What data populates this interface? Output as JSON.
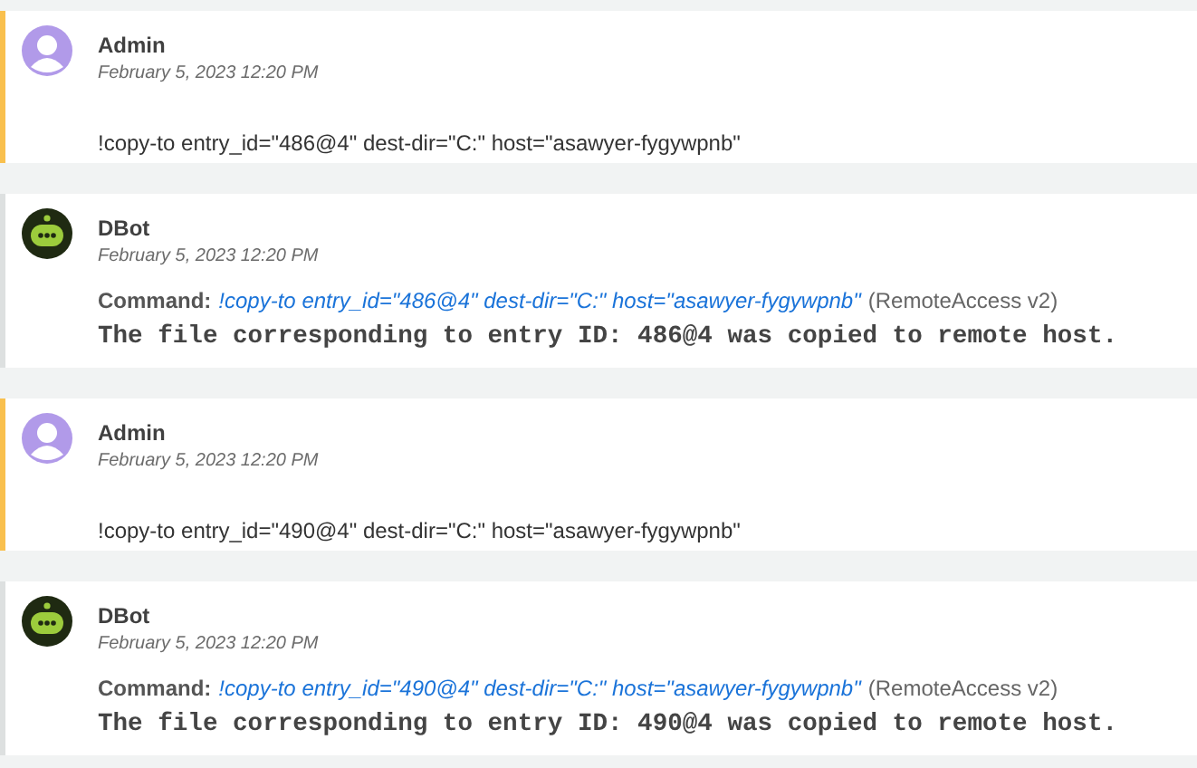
{
  "entries": [
    {
      "kind": "user",
      "author": "Admin",
      "time": "February 5, 2023 12:20 PM",
      "message": "!copy-to entry_id=\"486@4\" dest-dir=\"C:\" host=\"asawyer-fygywpnb\""
    },
    {
      "kind": "bot",
      "author": "DBot",
      "time": "February 5, 2023 12:20 PM",
      "command_label": "Command:",
      "command": "!copy-to entry_id=\"486@4\" dest-dir=\"C:\" host=\"asawyer-fygywpnb\"",
      "integration": "(RemoteAccess v2)",
      "output": "The file corresponding to entry ID: 486@4 was copied to remote host."
    },
    {
      "kind": "user",
      "author": "Admin",
      "time": "February 5, 2023 12:20 PM",
      "message": "!copy-to entry_id=\"490@4\" dest-dir=\"C:\" host=\"asawyer-fygywpnb\""
    },
    {
      "kind": "bot",
      "author": "DBot",
      "time": "February 5, 2023 12:20 PM",
      "command_label": "Command:",
      "command": "!copy-to entry_id=\"490@4\" dest-dir=\"C:\" host=\"asawyer-fygywpnb\"",
      "integration": "(RemoteAccess v2)",
      "output": "The file corresponding to entry ID: 490@4 was copied to remote host."
    }
  ]
}
